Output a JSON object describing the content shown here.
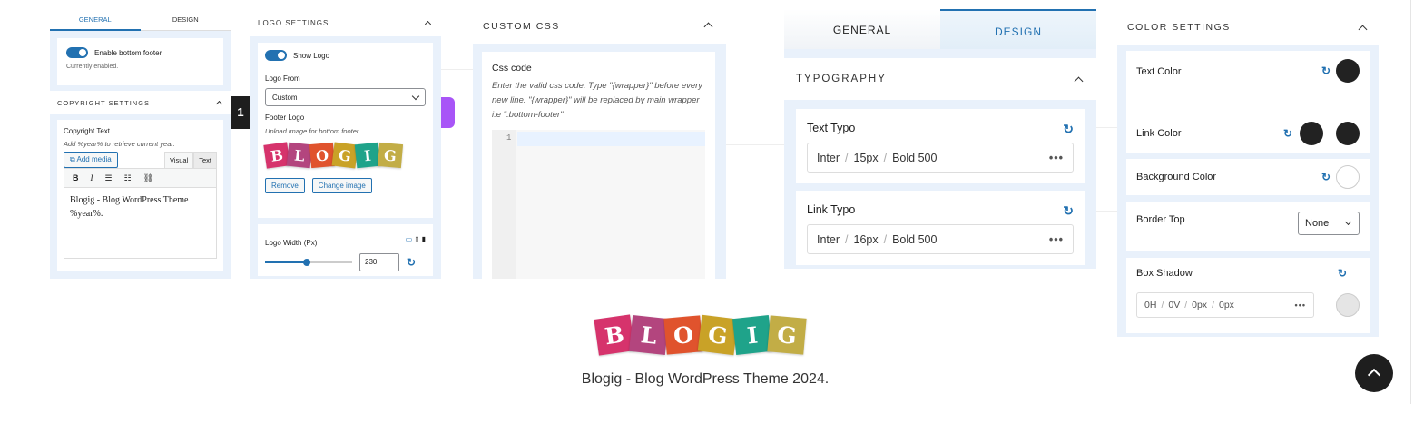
{
  "p1": {
    "tab_general": "GENERAL",
    "tab_design": "DESIGN",
    "toggle_label": "Enable bottom footer",
    "toggle_status": "Currently enabled.",
    "section_title": "COPYRIGHT SETTINGS",
    "field_label": "Copyright Text",
    "field_hint": "Add %year% to retrieve current year.",
    "add_media": "Add media",
    "tab_visual": "Visual",
    "tab_text": "Text",
    "editor_content": "Blogig - Blog WordPress Theme %year%."
  },
  "step_badge": "1",
  "p2": {
    "title": "LOGO SETTINGS",
    "show_logo": "Show Logo",
    "logo_from_label": "Logo From",
    "logo_from_value": "Custom",
    "footer_logo_label": "Footer Logo",
    "footer_logo_hint": "Upload image for bottom footer",
    "remove_btn": "Remove",
    "change_btn": "Change image",
    "width_label": "Logo Width (Px)",
    "width_value": "230",
    "slider_fraction": 0.48
  },
  "p3": {
    "title": "CUSTOM CSS",
    "field_label": "Css code",
    "hint": "Enter the valid css code. Type \"{wrapper}\" before every new line. \"{wrapper}\" will be replaced by main wrapper i.e \".bottom-footer\"",
    "line_number": "1"
  },
  "p4": {
    "tab_general": "GENERAL",
    "tab_design": "DESIGN",
    "section_title": "TYPOGRAPHY",
    "text_typo": {
      "label": "Text Typo",
      "font": "Inter",
      "size": "15px",
      "weight": "Bold 500"
    },
    "link_typo": {
      "label": "Link Typo",
      "font": "Inter",
      "size": "16px",
      "weight": "Bold 500"
    }
  },
  "p5": {
    "title": "COLOR SETTINGS",
    "text_color": "Text Color",
    "link_color": "Link Color",
    "bg_color": "Background Color",
    "border_top": "Border Top",
    "border_value": "None",
    "box_shadow": "Box Shadow",
    "shadow": {
      "h": "0H",
      "v": "0V",
      "blur": "0px",
      "spread": "0px"
    }
  },
  "logo_letters": [
    "B",
    "L",
    "O",
    "G",
    "I",
    "G"
  ],
  "footer_text": "Blogig - Blog WordPress Theme 2024.",
  "colors": {
    "accent": "#2271b1",
    "panel_bg": "#e9f1fb",
    "text_color_swatch": "#222222",
    "bg_color_swatch": "#ffffff",
    "shadow_swatch": "#e5e5e5",
    "logo_tiles": [
      "#d6336c",
      "#b3457e",
      "#e0532d",
      "#c9a227",
      "#1fa38a",
      "#c2ad46"
    ]
  },
  "icons": {
    "reset": "reset-icon",
    "scroll_top": "chevron-up-icon"
  }
}
